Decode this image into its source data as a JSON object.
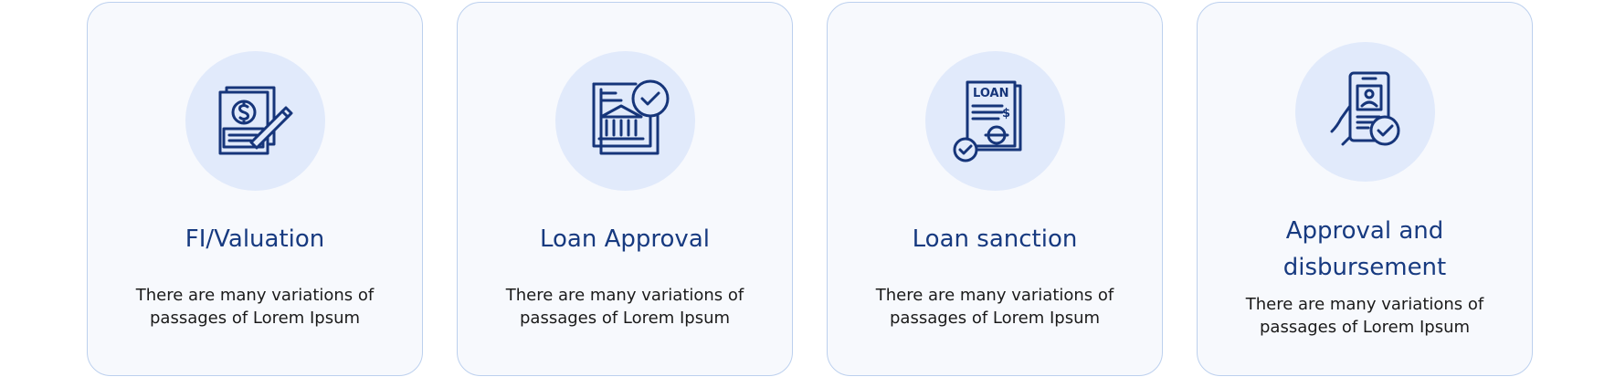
{
  "colors": {
    "card_background": "#f7f9fd",
    "card_border": "#bcd0ee",
    "icon_circle": "#e1eafb",
    "icon_stroke": "#16357a",
    "title": "#173a80",
    "description": "#1a1a1a"
  },
  "cards": [
    {
      "title": "FI/Valuation",
      "description": "There are many variations of passages of Lorem Ipsum",
      "icon": "valuation-document-icon"
    },
    {
      "title": "Loan Approval",
      "description": "There are many variations of passages of Lorem Ipsum",
      "icon": "bank-approval-icon"
    },
    {
      "title": "Loan sanction",
      "description": "There are many variations of passages of Lorem Ipsum",
      "icon": "loan-document-icon",
      "icon_text": "LOAN"
    },
    {
      "title": "Approval and disbursement",
      "description": "There are many variations of passages of Lorem Ipsum",
      "icon": "mobile-approval-icon"
    }
  ]
}
